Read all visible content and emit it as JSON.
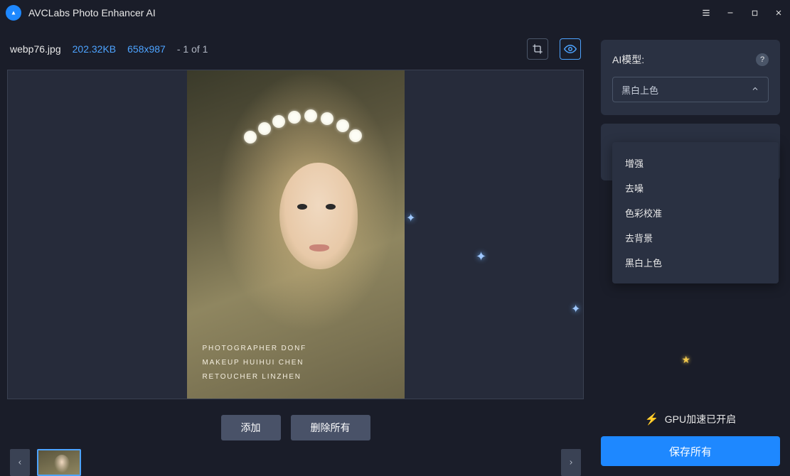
{
  "app": {
    "title": "AVCLabs Photo Enhancer AI"
  },
  "file": {
    "name": "webp76.jpg",
    "size": "202.32KB",
    "dimensions": "658x987",
    "counter": "- 1 of 1"
  },
  "photo_credits": {
    "line1": "Photographer Donf",
    "line2": "Makeup Huihui Chen",
    "line3": "Retoucher Linzhen"
  },
  "buttons": {
    "add": "添加",
    "remove_all": "删除所有",
    "save_all": "保存所有"
  },
  "side": {
    "model_label": "AI模型:",
    "selected_model": "黑白上色",
    "options": [
      "增强",
      "去噪",
      "色彩校准",
      "去背景",
      "黑白上色"
    ]
  },
  "gpu": {
    "status": "GPU加速已开启"
  }
}
